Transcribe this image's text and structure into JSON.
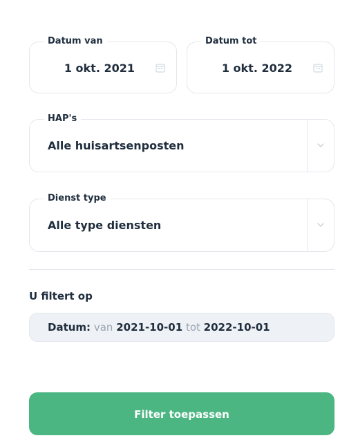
{
  "date_from": {
    "legend": "Datum van",
    "value": "1 okt. 2021",
    "icon": "calendar-icon"
  },
  "date_to": {
    "legend": "Datum tot",
    "value": "1 okt. 2022",
    "icon": "calendar-icon"
  },
  "hap_select": {
    "legend": "HAP's",
    "value": "Alle huisartsenposten",
    "icon": "chevron-down-icon"
  },
  "service_select": {
    "legend": "Dienst type",
    "value": "Alle type diensten",
    "icon": "chevron-down-icon"
  },
  "active_filters": {
    "heading": "U filtert op",
    "chip": {
      "label": "Datum:",
      "from_word": "van",
      "from_value": "2021-10-01",
      "to_word": "tot",
      "to_value": "2022-10-01"
    }
  },
  "apply_button": {
    "label": "Filter toepassen"
  },
  "colors": {
    "accent": "#4cb683",
    "text": "#1f2d3d",
    "muted": "#9aa5b2",
    "border": "#e3e7ec",
    "chip_bg": "#eef1f5"
  }
}
